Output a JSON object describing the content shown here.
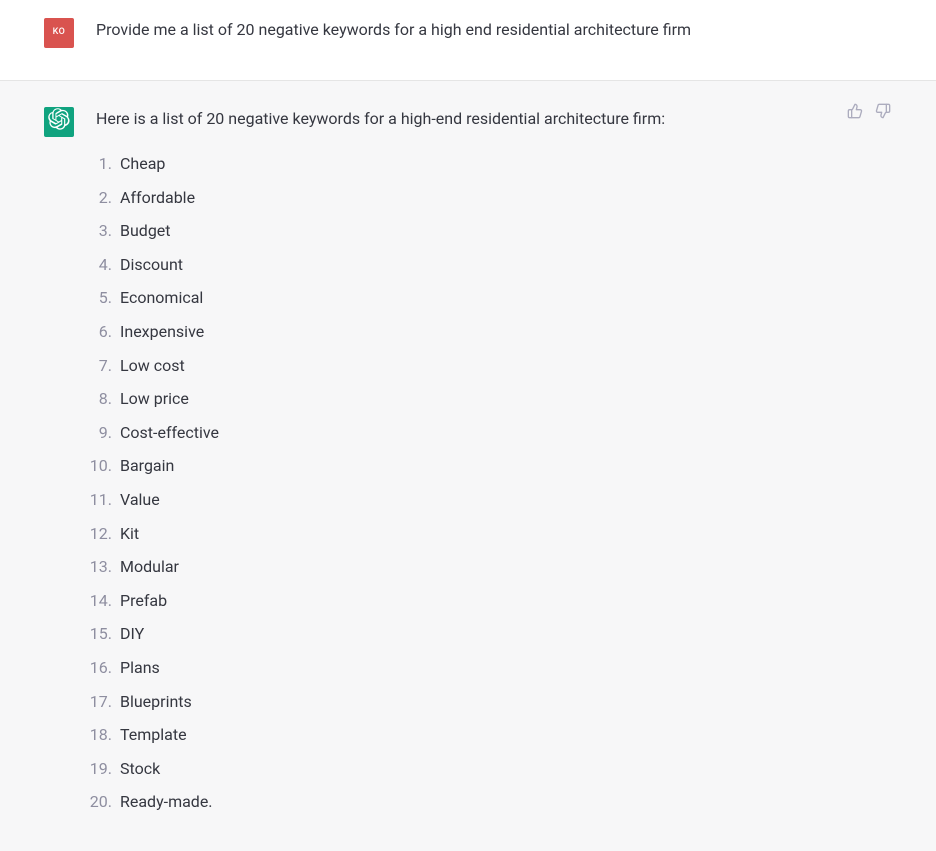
{
  "user": {
    "avatar_initials": "KO",
    "prompt": "Provide me a list of 20 negative keywords for a high end residential architecture firm"
  },
  "assistant": {
    "intro": "Here is a list of 20 negative keywords for a high-end residential architecture firm:",
    "items": [
      "Cheap",
      "Affordable",
      "Budget",
      "Discount",
      "Economical",
      "Inexpensive",
      "Low cost",
      "Low price",
      "Cost-effective",
      "Bargain",
      "Value",
      "Kit",
      "Modular",
      "Prefab",
      "DIY",
      "Plans",
      "Blueprints",
      "Template",
      "Stock",
      "Ready-made."
    ]
  }
}
